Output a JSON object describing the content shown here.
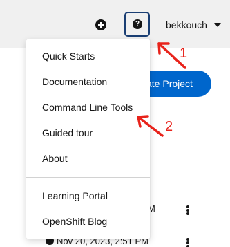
{
  "header": {
    "user_name": "bekkouch"
  },
  "background": {
    "create_button_label": "ate Project",
    "row1_time": "M",
    "row2_time": "Nov 20, 2023, 2:51 PM"
  },
  "help_menu": {
    "items": [
      {
        "label": "Quick Starts"
      },
      {
        "label": "Documentation"
      },
      {
        "label": "Command Line Tools"
      },
      {
        "label": "Guided tour"
      },
      {
        "label": "About"
      },
      {
        "label": "Learning Portal"
      },
      {
        "label": "OpenShift Blog"
      }
    ]
  },
  "annotations": {
    "arrow1_label": "1",
    "arrow2_label": "2",
    "color": "#e8231b"
  }
}
